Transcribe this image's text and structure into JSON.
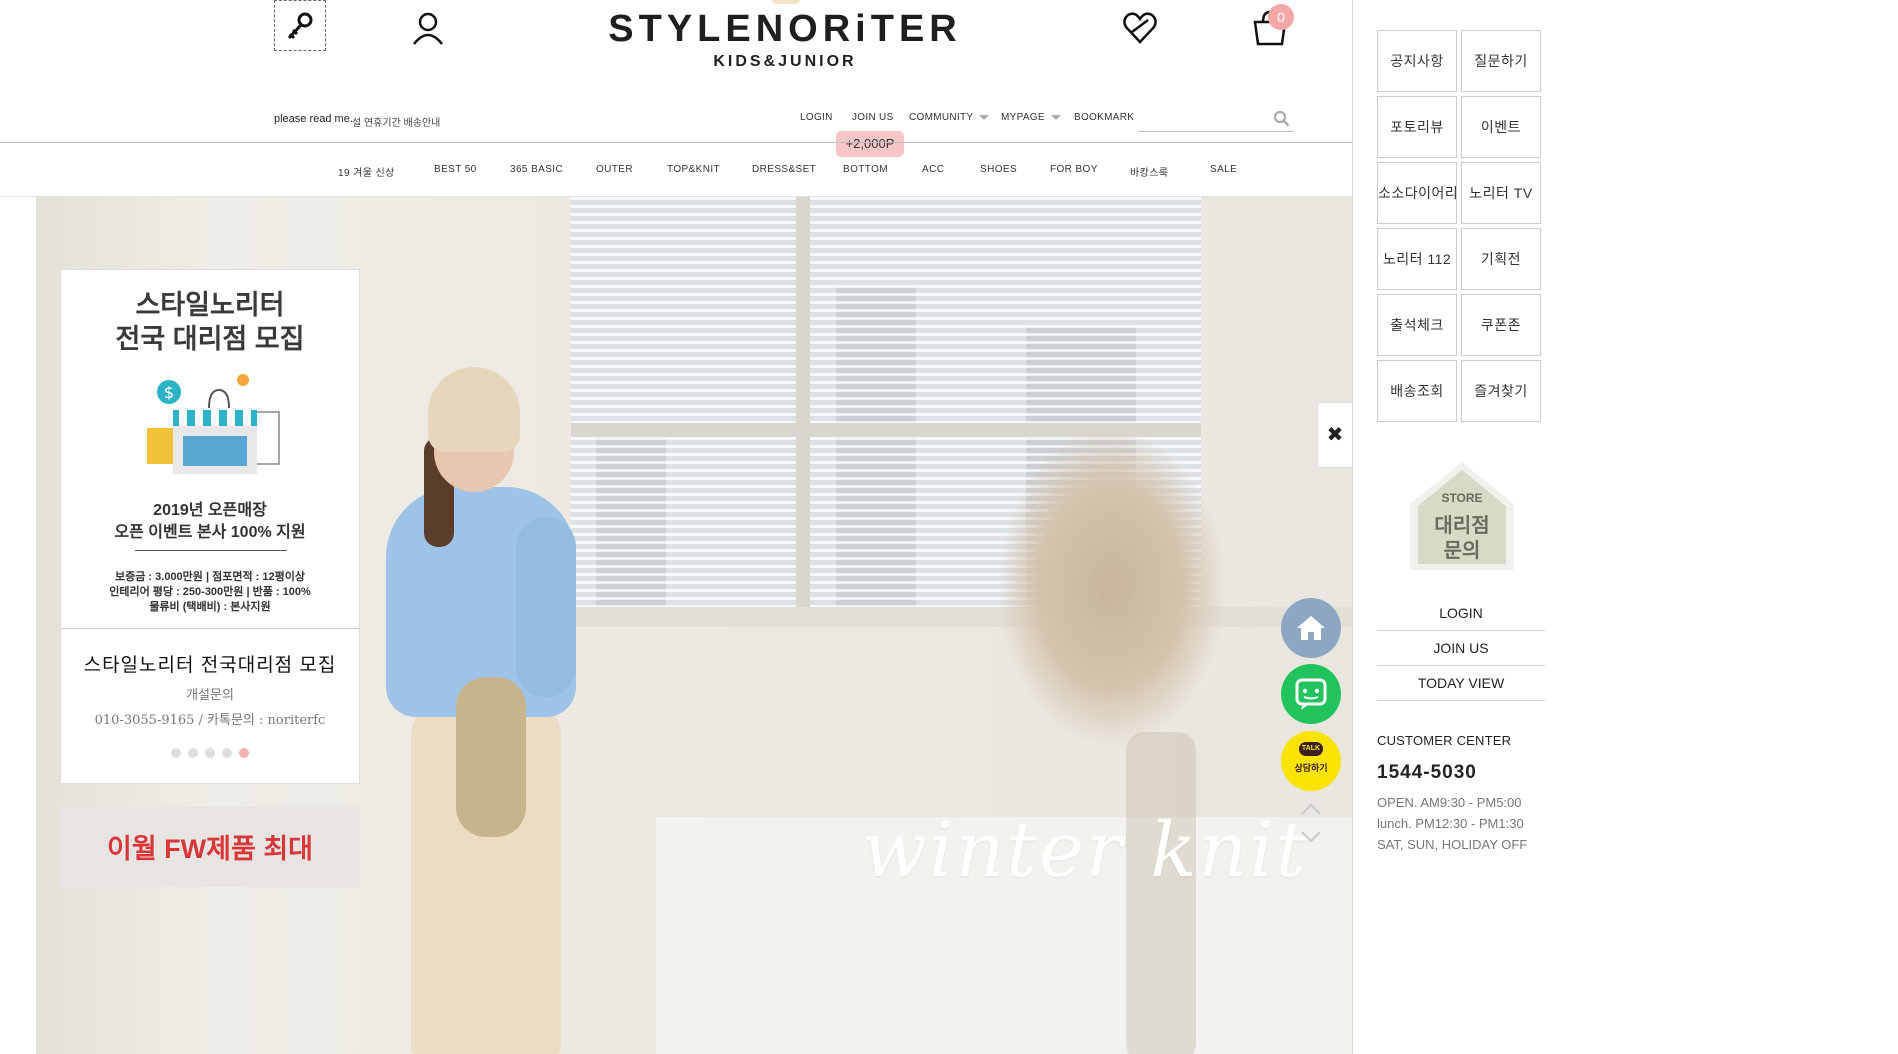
{
  "header": {
    "logo_main": "STYLENORiTER",
    "logo_sub": "KIDS&JUNIOR",
    "cart_count": "0",
    "notice_label": "please read me.",
    "notice_text": "설 연휴기간 배송안내",
    "point_tag": "+2,000P",
    "search_placeholder": ""
  },
  "topnav": [
    "LOGIN",
    "JOIN US",
    "COMMUNITY",
    "MYPAGE",
    "BOOKMARK"
  ],
  "categories": [
    "19 겨울 신상",
    "BEST 50",
    "365 BASIC",
    "OUTER",
    "TOP&KNIT",
    "DRESS&SET",
    "BOTTOM",
    "ACC",
    "SHOES",
    "FOR BOY",
    "바캉스룩",
    "SALE"
  ],
  "hero": {
    "script_text": "winter knit"
  },
  "popup": {
    "headline1": "스타일노리터",
    "headline2": "전국 대리점 모집",
    "line1": "2019년 오픈매장",
    "line2": "오픈 이벤트 본사 100% 지원",
    "detail1": "보증금 : 3.000만원 | 점포면적 : 12평이상",
    "detail2": "인테리어 평당 : 250-300만원 | 반품 : 100%",
    "detail3": "물류비 (택배비) : 본사지원",
    "title": "스타일노리터 전국대리점 모집",
    "subtitle": "개설문의",
    "phone": "010-3055-9165 / 카톡문의 : noriterfc",
    "dots": 5,
    "active_dot": 4
  },
  "popup2": {
    "text": "이월 FW제품 최대"
  },
  "close_label": "✖",
  "floating": {
    "talk_bubble": "TALK",
    "talk_text": "상담하기"
  },
  "side_grid": [
    "공지사항",
    "질문하기",
    "포토리뷰",
    "이벤트",
    "소소다이어리",
    "노리터 TV",
    "노리터 112",
    "기획전",
    "출석체크",
    "쿠폰존",
    "배송조회",
    "즐겨찾기"
  ],
  "store_badge": {
    "word": "STORE",
    "name1": "대리점",
    "name2": "문의"
  },
  "side_links": [
    "LOGIN",
    "JOIN US",
    "TODAY VIEW"
  ],
  "customer_center": {
    "title": "CUSTOMER CENTER",
    "phone": "1544-5030",
    "open": "OPEN. AM9:30 - PM5:00",
    "lunch": "lunch. PM12:30 - PM1:30",
    "holiday": "SAT, SUN, HOLIDAY OFF"
  },
  "colors": {
    "accent_pink": "#f4a7a7",
    "point_tag": "#f6c6c6",
    "home_fab": "#8da7c3",
    "chat_fab": "#22c25c",
    "talk_fab": "#fbe300",
    "popup2_text": "#d9363a"
  },
  "icons": [
    "key-icon",
    "user-icon",
    "heart-icon",
    "cart-icon",
    "search-icon",
    "home-icon",
    "chat-icon",
    "kakao-talk-icon",
    "arrow-up-icon",
    "arrow-down-icon",
    "close-icon"
  ]
}
